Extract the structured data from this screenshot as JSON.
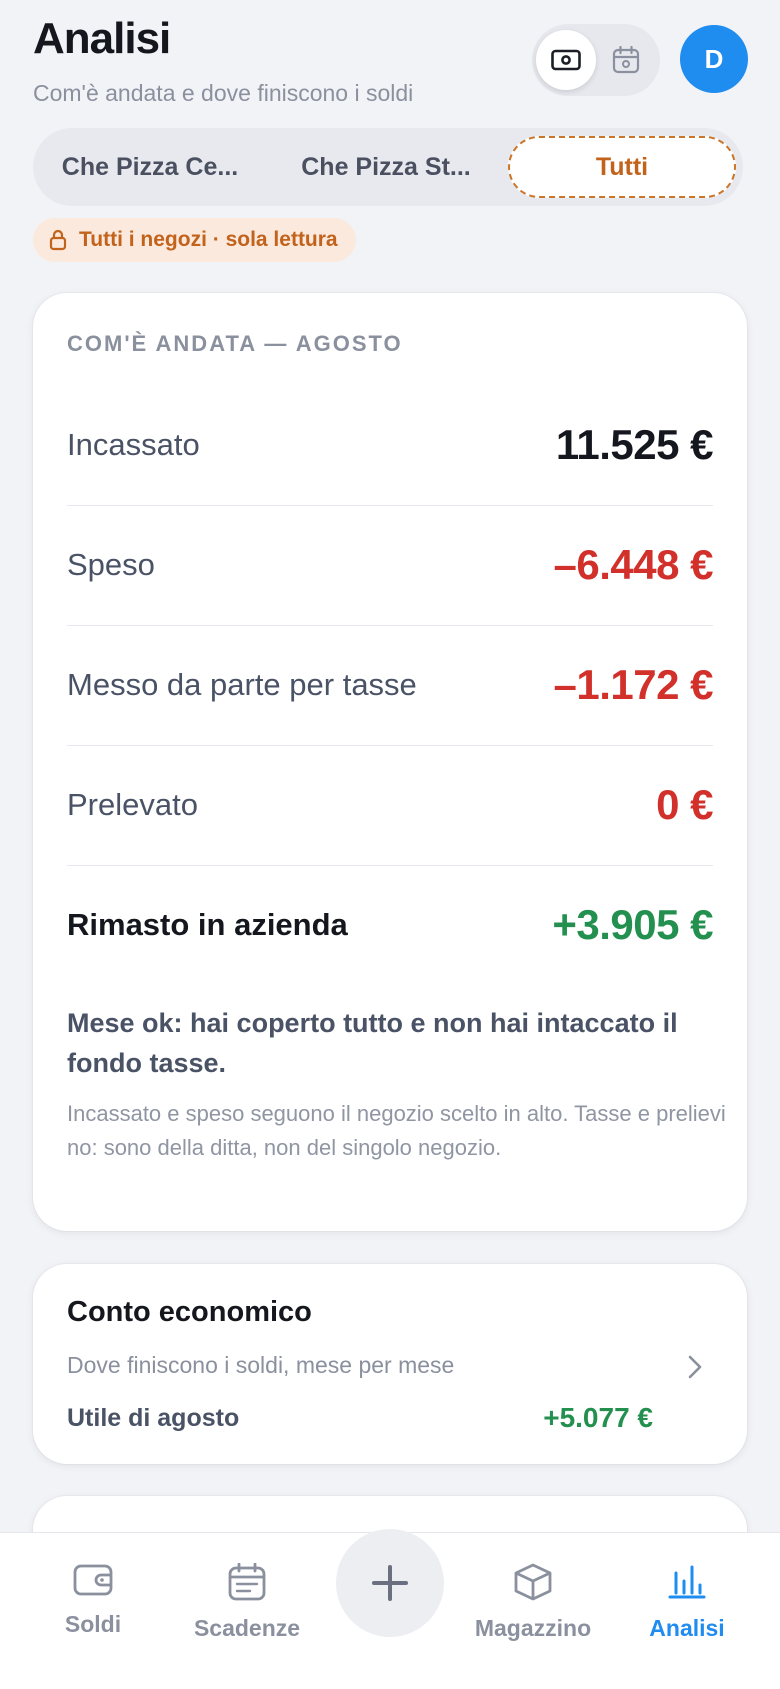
{
  "header": {
    "title": "Analisi",
    "subtitle": "Com'è andata e dove finiscono i soldi",
    "avatar_initial": "D"
  },
  "store_tabs": [
    "Che Pizza Ce...",
    "Che Pizza St...",
    "Tutti"
  ],
  "selected_store": "Tutti",
  "readonly_badge": "Tutti i negozi · sola lettura",
  "summary": {
    "section_title": "COM'È ANDATA — AGOSTO",
    "rows": [
      {
        "label": "Incassato",
        "value": "11.525 €"
      },
      {
        "label": "Speso",
        "value": "–6.448 €"
      },
      {
        "label": "Messo da parte per tasse",
        "value": "–1.172 €"
      },
      {
        "label": "Prelevato",
        "value": "0 €"
      },
      {
        "label": "Rimasto in azienda",
        "value": "+3.905 €"
      }
    ],
    "note_title": "Mese ok: hai coperto tutto e non hai intaccato il fondo tasse.",
    "note_text": "Incassato e speso seguono il negozio scelto in alto. Tasse e prelievi no: sono della ditta, non del singolo negozio."
  },
  "profit_loss": {
    "title": "Conto economico",
    "subtitle": "Dove finiscono i soldi, mese per mese",
    "utile_label": "Utile di agosto",
    "utile_value": "+5.077 €"
  },
  "bottom_nav": {
    "items": [
      {
        "label": "Soldi",
        "icon": "wallet-icon"
      },
      {
        "label": "Scadenze",
        "icon": "calendar-icon"
      },
      {
        "label": "Magazzino",
        "icon": "box-icon"
      },
      {
        "label": "Analisi",
        "icon": "bar-chart-icon"
      }
    ],
    "active": "Analisi"
  },
  "colors": {
    "accent": "#1f8cf0",
    "negative": "#d2302a",
    "positive": "#24904f",
    "store_highlight": "#c2621b"
  }
}
